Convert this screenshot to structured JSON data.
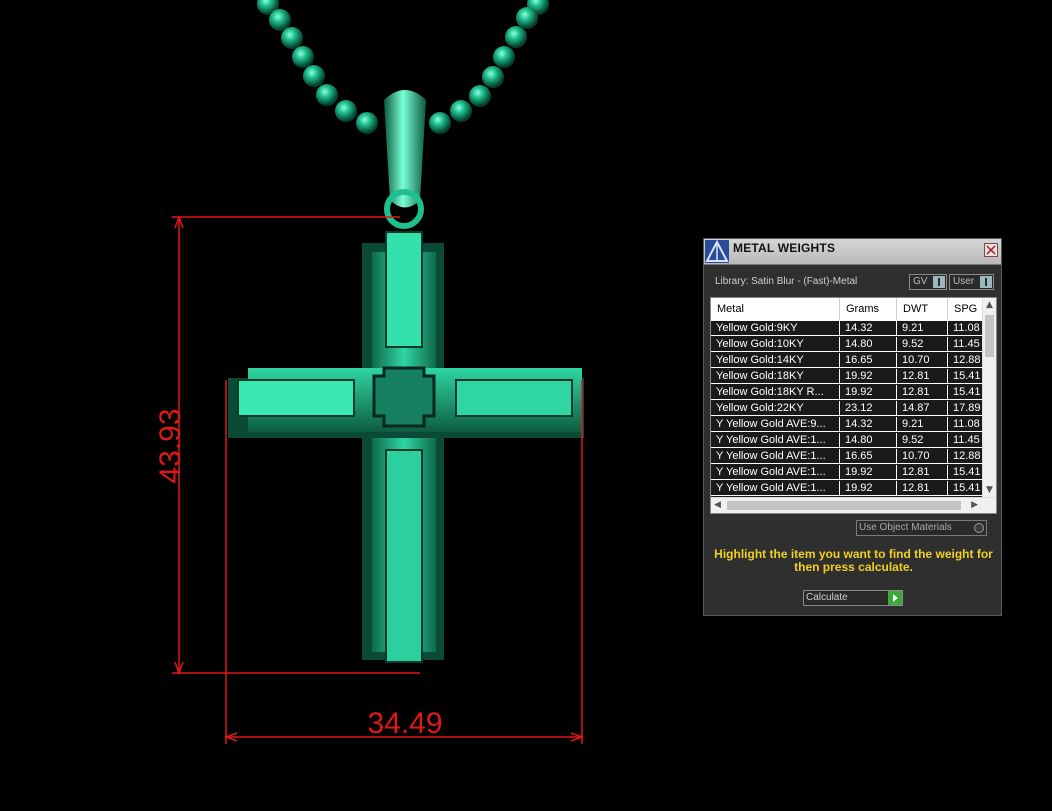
{
  "dimensions": {
    "height_label": "43.93",
    "width_label": "34.49",
    "color": "#e01818"
  },
  "model": {
    "description_color": "#1fbf8f"
  },
  "panel": {
    "title": "METAL WEIGHTS",
    "library_label": "Library: Satin Blur - (Fast)-Metal",
    "gv_select": "GV",
    "user_select": "User",
    "columns": [
      "Metal",
      "Grams",
      "DWT",
      "SPG"
    ],
    "rows": [
      {
        "metal": "Yellow Gold:9KY",
        "grams": "14.32",
        "dwt": "9.21",
        "spg": "11.08"
      },
      {
        "metal": "Yellow Gold:10KY",
        "grams": "14.80",
        "dwt": "9.52",
        "spg": "11.45"
      },
      {
        "metal": "Yellow Gold:14KY",
        "grams": "16.65",
        "dwt": "10.70",
        "spg": "12.88"
      },
      {
        "metal": "Yellow Gold:18KY",
        "grams": "19.92",
        "dwt": "12.81",
        "spg": "15.41"
      },
      {
        "metal": "Yellow Gold:18KY R...",
        "grams": "19.92",
        "dwt": "12.81",
        "spg": "15.41"
      },
      {
        "metal": "Yellow Gold:22KY",
        "grams": "23.12",
        "dwt": "14.87",
        "spg": "17.89"
      },
      {
        "metal": "Y Yellow Gold AVE:9...",
        "grams": "14.32",
        "dwt": "9.21",
        "spg": "11.08"
      },
      {
        "metal": "Y Yellow Gold AVE:1...",
        "grams": "14.80",
        "dwt": "9.52",
        "spg": "11.45"
      },
      {
        "metal": "Y Yellow Gold AVE:1...",
        "grams": "16.65",
        "dwt": "10.70",
        "spg": "12.88"
      },
      {
        "metal": "Y Yellow Gold AVE:1...",
        "grams": "19.92",
        "dwt": "12.81",
        "spg": "15.41"
      },
      {
        "metal": "Y Yellow Gold AVE:1...",
        "grams": "19.92",
        "dwt": "12.81",
        "spg": "15.41"
      }
    ],
    "use_object_materials": "Use Object Materials",
    "instruction": "Highlight the item you want to find the weight for then press calculate.",
    "calculate_label": "Calculate",
    "icons": {
      "logo": "triangle-logo-icon",
      "close": "close-icon",
      "calculate": "play-arrow-icon"
    }
  }
}
